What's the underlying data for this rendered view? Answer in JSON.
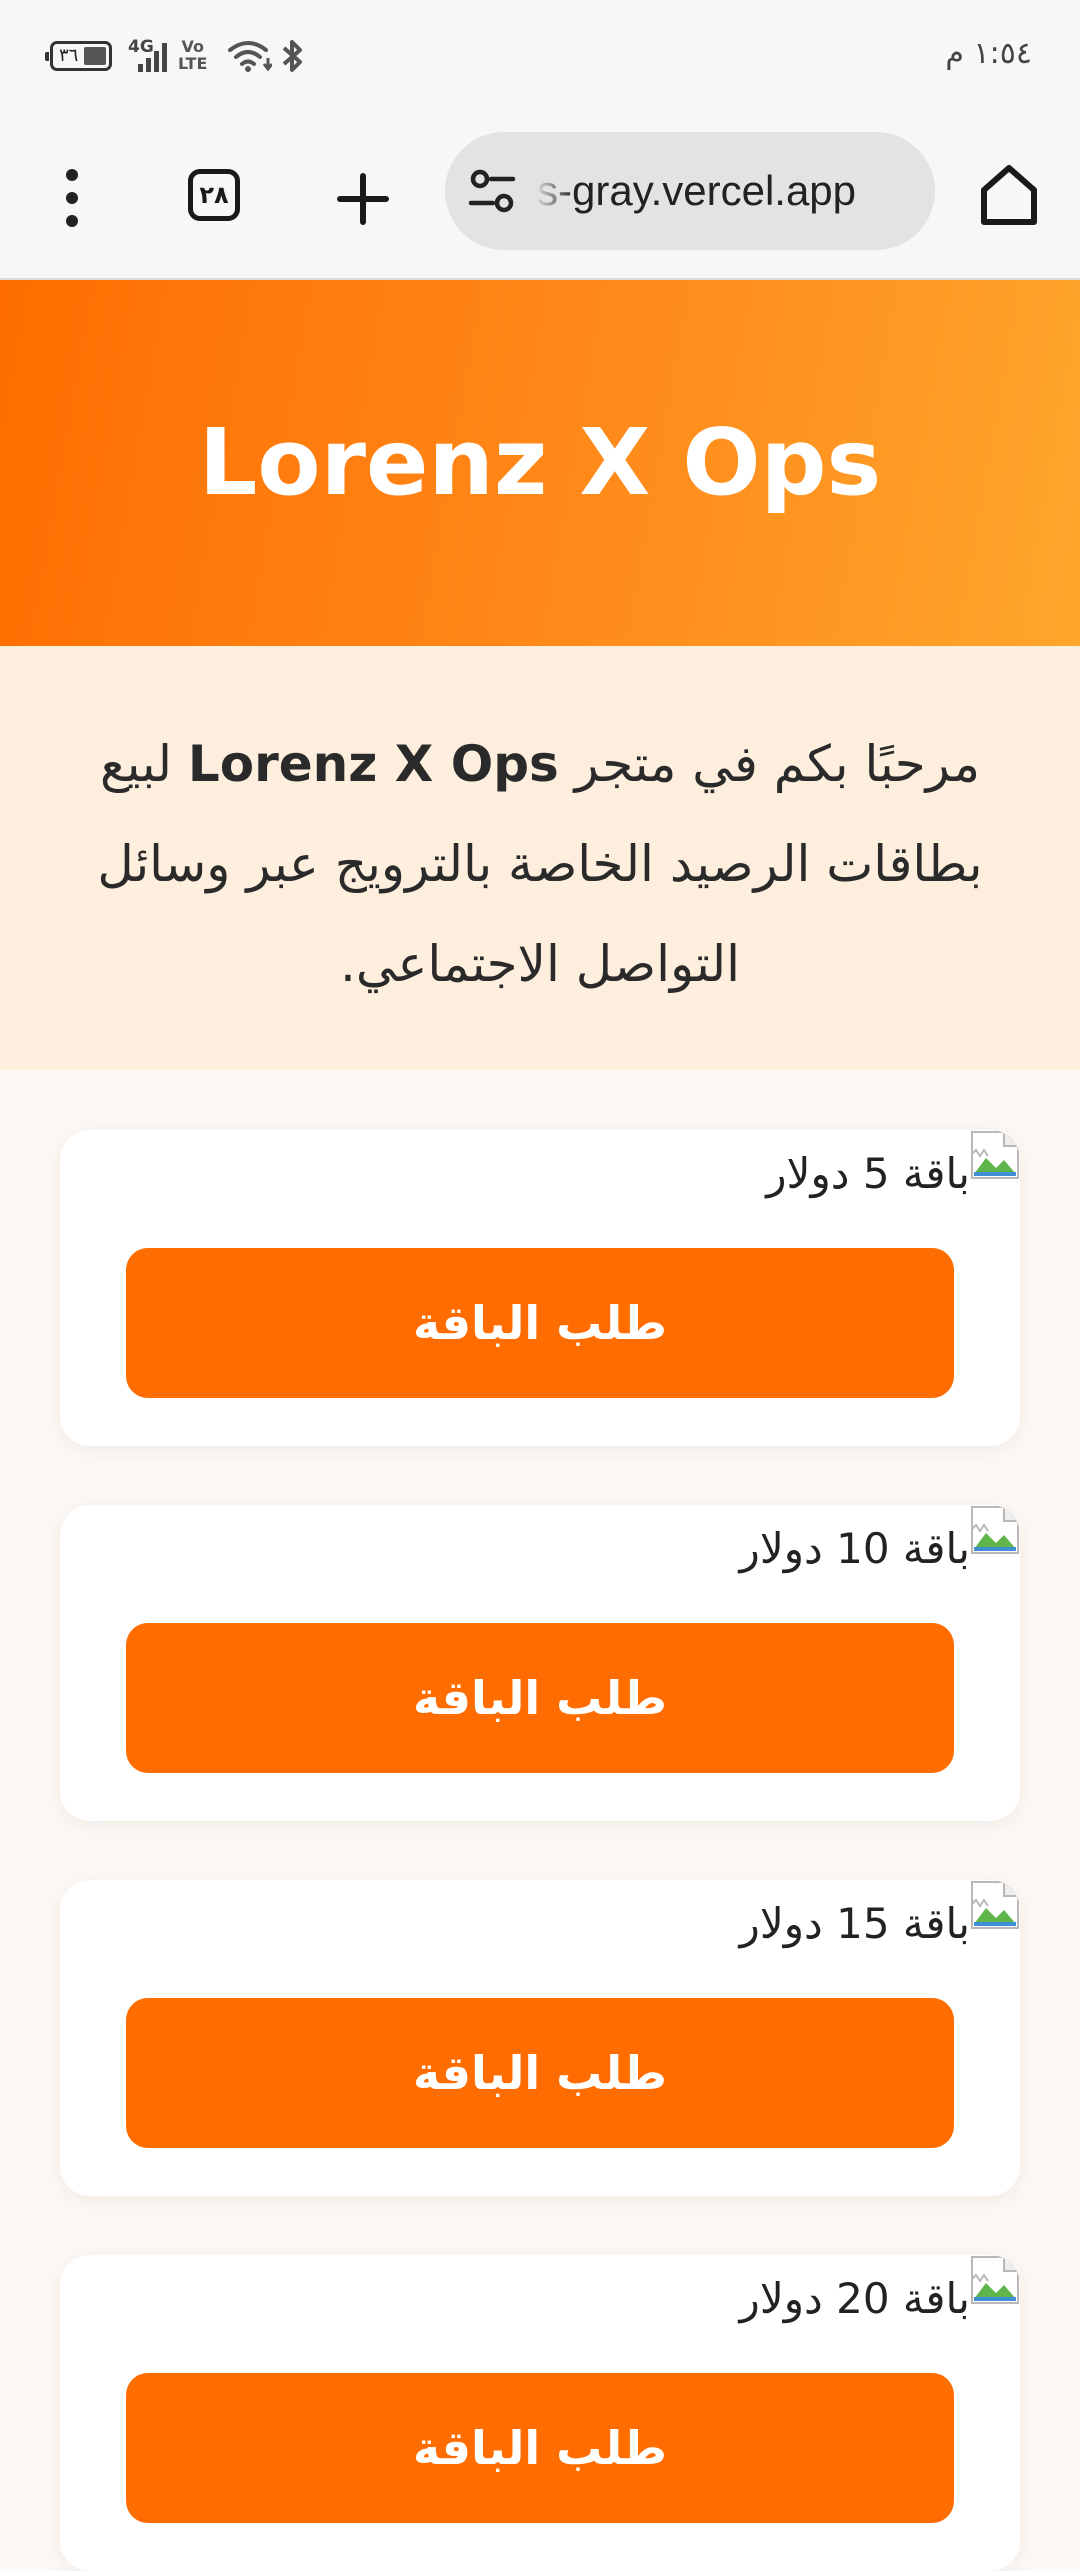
{
  "status_bar": {
    "battery": "٣٦",
    "network": "4G",
    "volte": "Vo\nLTE",
    "time": "١:٥٤ م"
  },
  "browser": {
    "tab_count": "٢٨",
    "url": "s-gray.vercel.app",
    "icons": [
      "more-vert-icon",
      "tab-switcher-icon",
      "plus-icon",
      "site-settings-icon",
      "home-icon"
    ]
  },
  "header": {
    "title": "Lorenz X Ops"
  },
  "welcome": {
    "before": "مرحبًا بكم في متجر ",
    "brand": "Lorenz X Ops",
    "after": " لبيع بطاقات الرصيد الخاصة بالترويج عبر وسائل التواصل الاجتماعي."
  },
  "packages": [
    {
      "title": "باقة 5 دولار",
      "button": "طلب الباقة"
    },
    {
      "title": "باقة 10 دولار",
      "button": "طلب الباقة"
    },
    {
      "title": "باقة 15 دولار",
      "button": "طلب الباقة"
    },
    {
      "title": "باقة 20 دولار",
      "button": "طلب الباقة"
    }
  ],
  "colors": {
    "accent": "#ff6d00",
    "hero_end": "#ffa62b",
    "welcome_bg": "#fdeedd",
    "page_bg": "#fdf8f3"
  }
}
